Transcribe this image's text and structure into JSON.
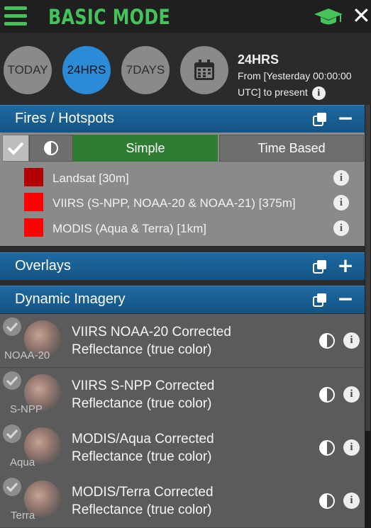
{
  "header": {
    "title": "BASIC MODE"
  },
  "time": {
    "buttons": [
      "TODAY",
      "24HRS",
      "7DAYS"
    ],
    "active": "24HRS",
    "summary_title": "24HRS",
    "summary_line1": "From [Yesterday 00:00:00",
    "summary_line2": "UTC] to present",
    "info_glyph": "i"
  },
  "fires": {
    "title": "Fires / Hotspots",
    "tabs": {
      "simple": "Simple",
      "time_based": "Time Based"
    },
    "legend": [
      {
        "label": "Landsat [30m]",
        "color": "#b30000"
      },
      {
        "label": "VIIRS (S-NPP, NOAA-20 & NOAA-21) [375m]",
        "color": "#ff0000"
      },
      {
        "label": "MODIS (Aqua & Terra) [1km]",
        "color": "#ff0000"
      }
    ]
  },
  "overlays": {
    "title": "Overlays"
  },
  "dynamic": {
    "title": "Dynamic Imagery",
    "items": [
      {
        "thumb": "NOAA-20",
        "title1": "VIIRS NOAA-20 Corrected",
        "title2": "Reflectance (true color)"
      },
      {
        "thumb": "S-NPP",
        "title1": "VIIRS S-NPP Corrected",
        "title2": "Reflectance (true color)"
      },
      {
        "thumb": "Aqua",
        "title1": "MODIS/Aqua Corrected",
        "title2": "Reflectance (true color)"
      },
      {
        "thumb": "Terra",
        "title1": "MODIS/Terra Corrected",
        "title2": "Reflectance (true color)"
      }
    ]
  },
  "icons": {
    "menu": "hamburger-menu-icon",
    "education": "graduation-cap-icon",
    "close": "close-icon",
    "calendar": "calendar-icon",
    "copy": "copy-icon",
    "contrast": "contrast-icon",
    "check": "check-icon",
    "info": "info-icon"
  },
  "colors": {
    "accent_green": "#45c35a",
    "header_blue": "#1f6aa1",
    "active_blue": "#2c8bd6",
    "simple_green": "#2e7d32"
  }
}
